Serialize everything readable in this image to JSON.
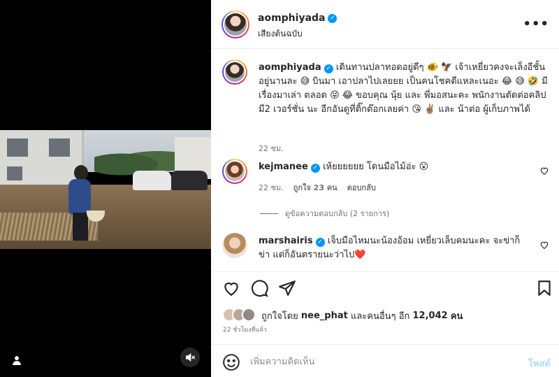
{
  "post": {
    "author": "aomphiyada",
    "audio": "เสียงต้นฉบับ",
    "caption": "เดินทานปลาทอดอยู่ดีๆ 🐠 🦅 เจ้าเหยี่ยวคงจะเล็งอีชั้นอยู่นานละ 😅 บินมา เอาปลาไปเลยยย เป็นคนโชคดีแหละเนอะ 😂 😅 🤣 มีเรื่องมาเล่า ตลอด 😝 😂 ขอบคุณ นุ้ย และ พี่มอสนะคะ พนักงานตัดต่อคลิป มี2 เวอร์ชั่น นะ อีกอันดูที่ติ๊กต๊อกเลยค่า 😘 ✌🏽 และ น้าต่อ ผู้เก็บภาพได้",
    "caption_time": "22 ชม."
  },
  "comments": [
    {
      "user": "kejmanee",
      "text": "เห้ยยยยยย โดนมือไม้อ่ะ 😮",
      "time": "22 ชม.",
      "likes": "ถูกใจ 23 คน",
      "reply": "ตอบกลับ",
      "view_replies": "ดูข้อความตอบกลับ (2 รายการ)"
    },
    {
      "user": "marshairis",
      "text": "เจ็บมือไหมนะน้องอ้อม เหยี่ยวเล็บคมนะคะ จะข่าก็ข่า แต่ก็อันตรายนะว่าไป❤️"
    }
  ],
  "likes": {
    "prefix": "ถูกใจโดย",
    "user": "nee_phat",
    "middle": "และคนอื่นๆ อีก",
    "count": "12,042",
    "suffix": "คน"
  },
  "time_ago": "22 ชั่วโมงที่แล้ว",
  "composer": {
    "placeholder": "เพิ่มความคิดเห็น",
    "post_label": "โพสต์"
  },
  "icons": {
    "more": "more-horizontal-icon",
    "like": "heart-icon",
    "comment": "comment-icon",
    "share": "share-icon",
    "save": "bookmark-icon",
    "emoji": "emoji-icon",
    "mute": "mute-icon",
    "tag": "user-tag-icon"
  },
  "colors": {
    "verified": "#0095f6",
    "post_disabled": "#b2dffc",
    "muted_text": "#737373"
  }
}
